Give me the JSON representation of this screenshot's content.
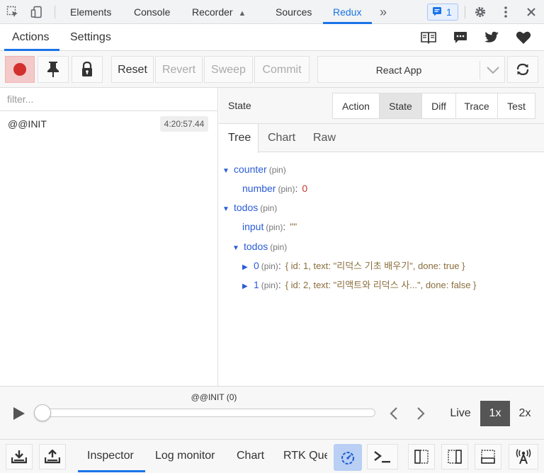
{
  "devtools": {
    "tabs": [
      "Elements",
      "Console",
      "Recorder",
      "Sources",
      "Redux"
    ],
    "more": "»",
    "issues_count": "1"
  },
  "header": {
    "tabs": [
      "Actions",
      "Settings"
    ]
  },
  "toolbar": {
    "reset": "Reset",
    "revert": "Revert",
    "sweep": "Sweep",
    "commit": "Commit",
    "instance": "React App"
  },
  "actions": {
    "filter_placeholder": "filter...",
    "items": [
      {
        "name": "@@INIT",
        "time": "4:20:57.44"
      }
    ]
  },
  "inspector": {
    "title": "State",
    "tabs": [
      "Action",
      "State",
      "Diff",
      "Trace",
      "Test"
    ],
    "view_tabs": [
      "Tree",
      "Chart",
      "Raw"
    ],
    "pin": "(pin)",
    "tree": {
      "counter": "counter",
      "number_key": "number",
      "number_val": "0",
      "todos": "todos",
      "input_key": "input",
      "input_val": "\"\"",
      "todos_inner": "todos",
      "item0_key": "0",
      "item0_val": "{ id: 1, text: \"리덕스 기초 배우기\", done: true }",
      "item1_key": "1",
      "item1_val": "{ id: 2, text: \"리액트와 리덕스 사...\", done: false }"
    }
  },
  "slider": {
    "label": "@@INIT (0)",
    "live": "Live",
    "speed_1x": "1x",
    "speed_2x": "2x"
  },
  "bottom": {
    "tabs": [
      "Inspector",
      "Log monitor",
      "Chart",
      "RTK Que"
    ]
  }
}
